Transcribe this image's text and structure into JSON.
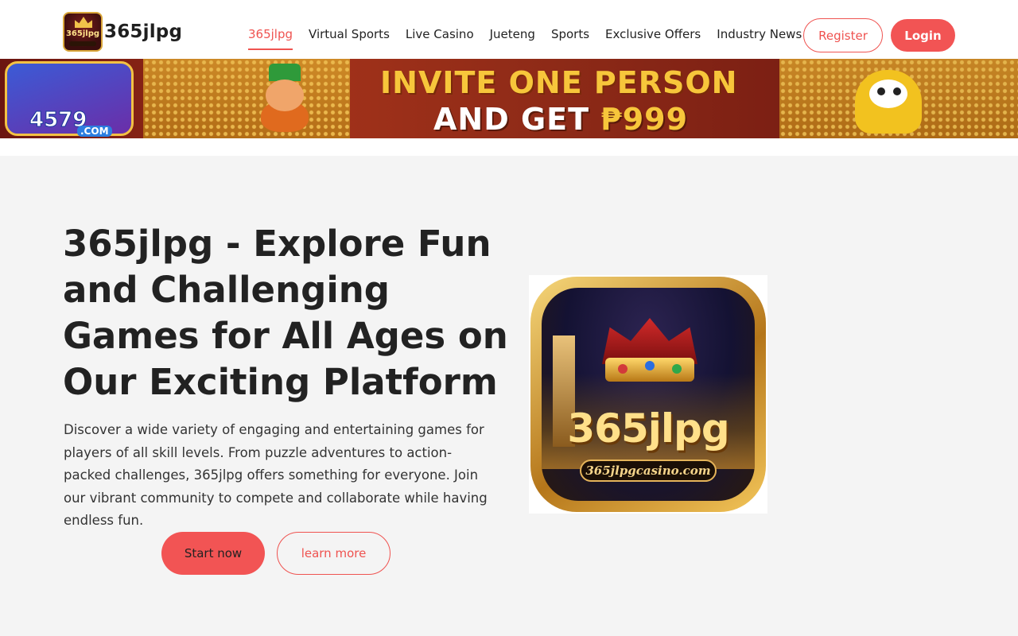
{
  "header": {
    "logo_badge_text": "365jlpg",
    "site_name": "365jlpg",
    "nav": [
      {
        "label": "365jlpg",
        "active": true
      },
      {
        "label": "Virtual Sports",
        "active": false
      },
      {
        "label": "Live Casino",
        "active": false
      },
      {
        "label": "Jueteng",
        "active": false
      },
      {
        "label": "Sports",
        "active": false
      },
      {
        "label": "Exclusive Offers",
        "active": false
      },
      {
        "label": "Industry News",
        "active": false
      }
    ],
    "register_label": "Register",
    "login_label": "Login"
  },
  "banner": {
    "brand": "4579",
    "brand_domain": ".COM",
    "line1": "INVITE ONE PERSON",
    "line2_prefix": "AND GET ",
    "line2_amount": "₱999"
  },
  "hero": {
    "title": "365jlpg - Explore Fun and Challenging Games for All Ages on Our Exciting Platform",
    "description": "Discover a wide variety of engaging and entertaining games for players of all skill levels. From puzzle adventures to action-packed challenges, 365jlpg offers something for everyone. Join our vibrant community to compete and collaborate while having endless fun.",
    "start_label": "Start now",
    "learn_label": "learn more"
  },
  "app_image": {
    "brand": "365jlpg",
    "domain": "365jlpgcasino.com"
  },
  "colors": {
    "accent": "#ef5350",
    "button_fill": "#f25454",
    "page_bg": "#f4f4f4"
  }
}
